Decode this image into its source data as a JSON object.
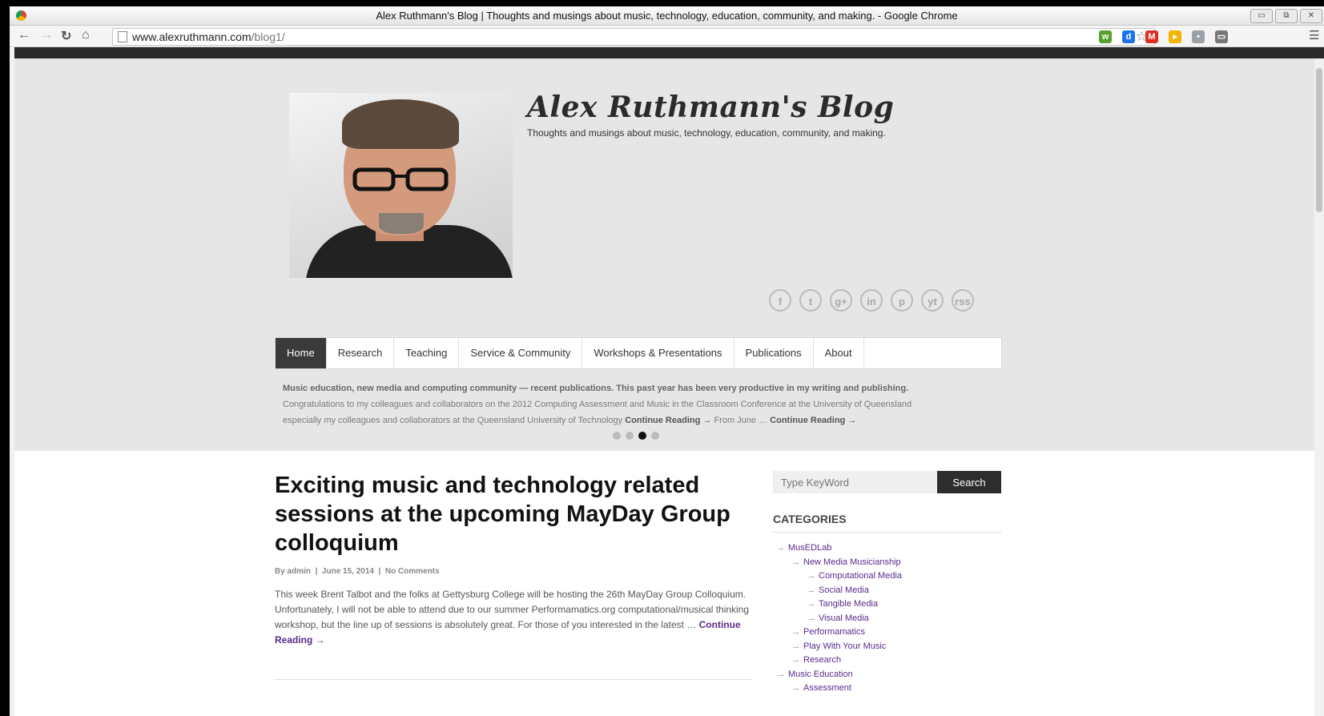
{
  "window": {
    "title": "Alex Ruthmann's Blog | Thoughts and musings about music, technology, education, community, and making. - Google Chrome"
  },
  "browser": {
    "url_host": "www.alexruthmann.com",
    "url_path": "/blog1/",
    "extensions": [
      {
        "icon": "extension-green-icon",
        "color": "#5aa02c",
        "glyph": "w"
      },
      {
        "icon": "extension-blue-icon",
        "color": "#1a73e8",
        "glyph": "d"
      },
      {
        "icon": "gmail-icon",
        "color": "#d93025",
        "glyph": "M"
      },
      {
        "icon": "extension-yellow-icon",
        "color": "#f4b400",
        "glyph": "▸"
      },
      {
        "icon": "extension-gray-icon",
        "color": "#9aa0a6",
        "glyph": "•"
      },
      {
        "icon": "cast-icon",
        "color": "#777777",
        "glyph": "▭"
      }
    ]
  },
  "header": {
    "blog_title": "Alex Ruthmann's Blog",
    "tagline": "Thoughts and musings about music, technology, education, community, and making."
  },
  "socials": [
    "f",
    "t",
    "g+",
    "in",
    "p",
    "yt",
    "rss"
  ],
  "nav": {
    "items": [
      "Home",
      "Research",
      "Teaching",
      "Service & Community",
      "Workshops & Presentations",
      "Publications",
      "About"
    ],
    "active": "Home"
  },
  "slider": {
    "line1": "Music education, new media and computing community — recent publications. This past year has been very productive in my writing and publishing.",
    "line2": "Congratulations to my colleagues and collaborators on the 2012 Computing Assessment and Music in the Classroom Conference at the University of Queensland",
    "line3": "especially my colleagues and collaborators at the Queensland University of Technology",
    "continue1": "Continue Reading →",
    "from_june": "From June …",
    "continue2": "Continue Reading →",
    "active_dot": 3,
    "dot_count": 4
  },
  "post": {
    "title": "Exciting music and technology related sessions at the upcoming MayDay Group colloquium",
    "author": "By admin",
    "date": "June 15, 2014",
    "comments": "No Comments",
    "excerpt": "This week Brent Talbot and the folks at Gettysburg College will be hosting the 26th MayDay Group Colloquium. Unfortunately, I will not be able to attend due to our summer Performamatics.org computational/musical thinking workshop, but the line up of sessions is absolutely great. For those of you interested in the latest …",
    "continue": "Continue Reading →"
  },
  "sidebar": {
    "search_placeholder": "Type KeyWord",
    "search_button": "Search",
    "categories_heading": "CATEGORIES",
    "categories": [
      {
        "label": "MusEDLab",
        "level": 0
      },
      {
        "label": "New Media Musicianship",
        "level": 1
      },
      {
        "label": "Computational Media",
        "level": 2
      },
      {
        "label": "Social Media",
        "level": 2
      },
      {
        "label": "Tangible Media",
        "level": 2
      },
      {
        "label": "Visual Media",
        "level": 2
      },
      {
        "label": "Performamatics",
        "level": 1
      },
      {
        "label": "Play With Your Music",
        "level": 1
      },
      {
        "label": "Research",
        "level": 1
      },
      {
        "label": "Music Education",
        "level": 0
      },
      {
        "label": "Assessment",
        "level": 1
      }
    ]
  }
}
